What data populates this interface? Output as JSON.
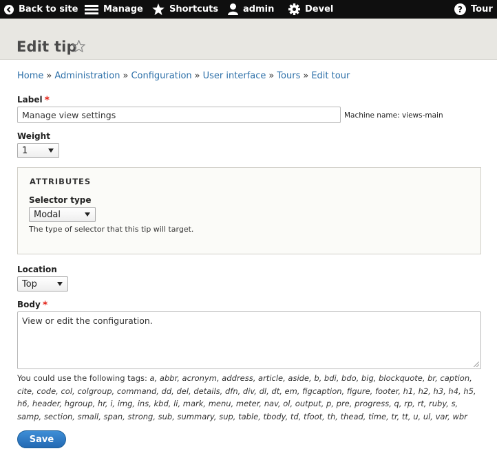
{
  "toolbar": {
    "back_label": "Back to site",
    "manage_label": "Manage",
    "shortcuts_label": "Shortcuts",
    "user_label": "admin",
    "devel_label": "Devel",
    "tour_label": "Tour"
  },
  "header": {
    "title": "Edit tip"
  },
  "breadcrumb": {
    "items": [
      "Home",
      "Administration",
      "Configuration",
      "User interface",
      "Tours",
      "Edit tour"
    ],
    "separator": "»"
  },
  "form": {
    "label_field": {
      "label": "Label",
      "required_marker": "*",
      "value": "Manage view settings",
      "machine_name": "Machine name: views-main"
    },
    "weight": {
      "label": "Weight",
      "value": "1"
    },
    "attributes": {
      "legend": "ATTRIBUTES",
      "selector_type": {
        "label": "Selector type",
        "value": "Modal",
        "description": "The type of selector that this tip will target."
      }
    },
    "location": {
      "label": "Location",
      "value": "Top"
    },
    "body": {
      "label": "Body",
      "required_marker": "*",
      "value": "View or edit the configuration.",
      "help_prefix": "You could use the following tags: ",
      "help_tags": "a, abbr, acronym, address, article, aside, b, bdi, bdo, big, blockquote, br, caption, cite, code, col, colgroup, command, dd, del, details, dfn, div, dl, dt, em, figcaption, figure, footer, h1, h2, h3, h4, h5, h6, header, hgroup, hr, i, img, ins, kbd, li, mark, menu, meter, nav, ol, output, p, pre, progress, q, rp, rt, ruby, s, samp, section, small, span, strong, sub, summary, sup, table, tbody, td, tfoot, th, thead, time, tr, tt, u, ul, var, wbr"
    },
    "save_label": "Save"
  },
  "colors": {
    "toolbar_bg": "#0f0f0f",
    "header_bg": "#e8e7e2",
    "link": "#2c6fa8",
    "required": "#e3261b",
    "primary_button": "#2a73bd"
  },
  "icons": {
    "back": "arrow-left-circle-icon",
    "manage": "hamburger-menu-icon",
    "shortcuts": "star-icon",
    "user": "person-icon",
    "devel": "gear-icon",
    "tour": "question-circle-icon",
    "favorite": "star-outline-icon"
  }
}
